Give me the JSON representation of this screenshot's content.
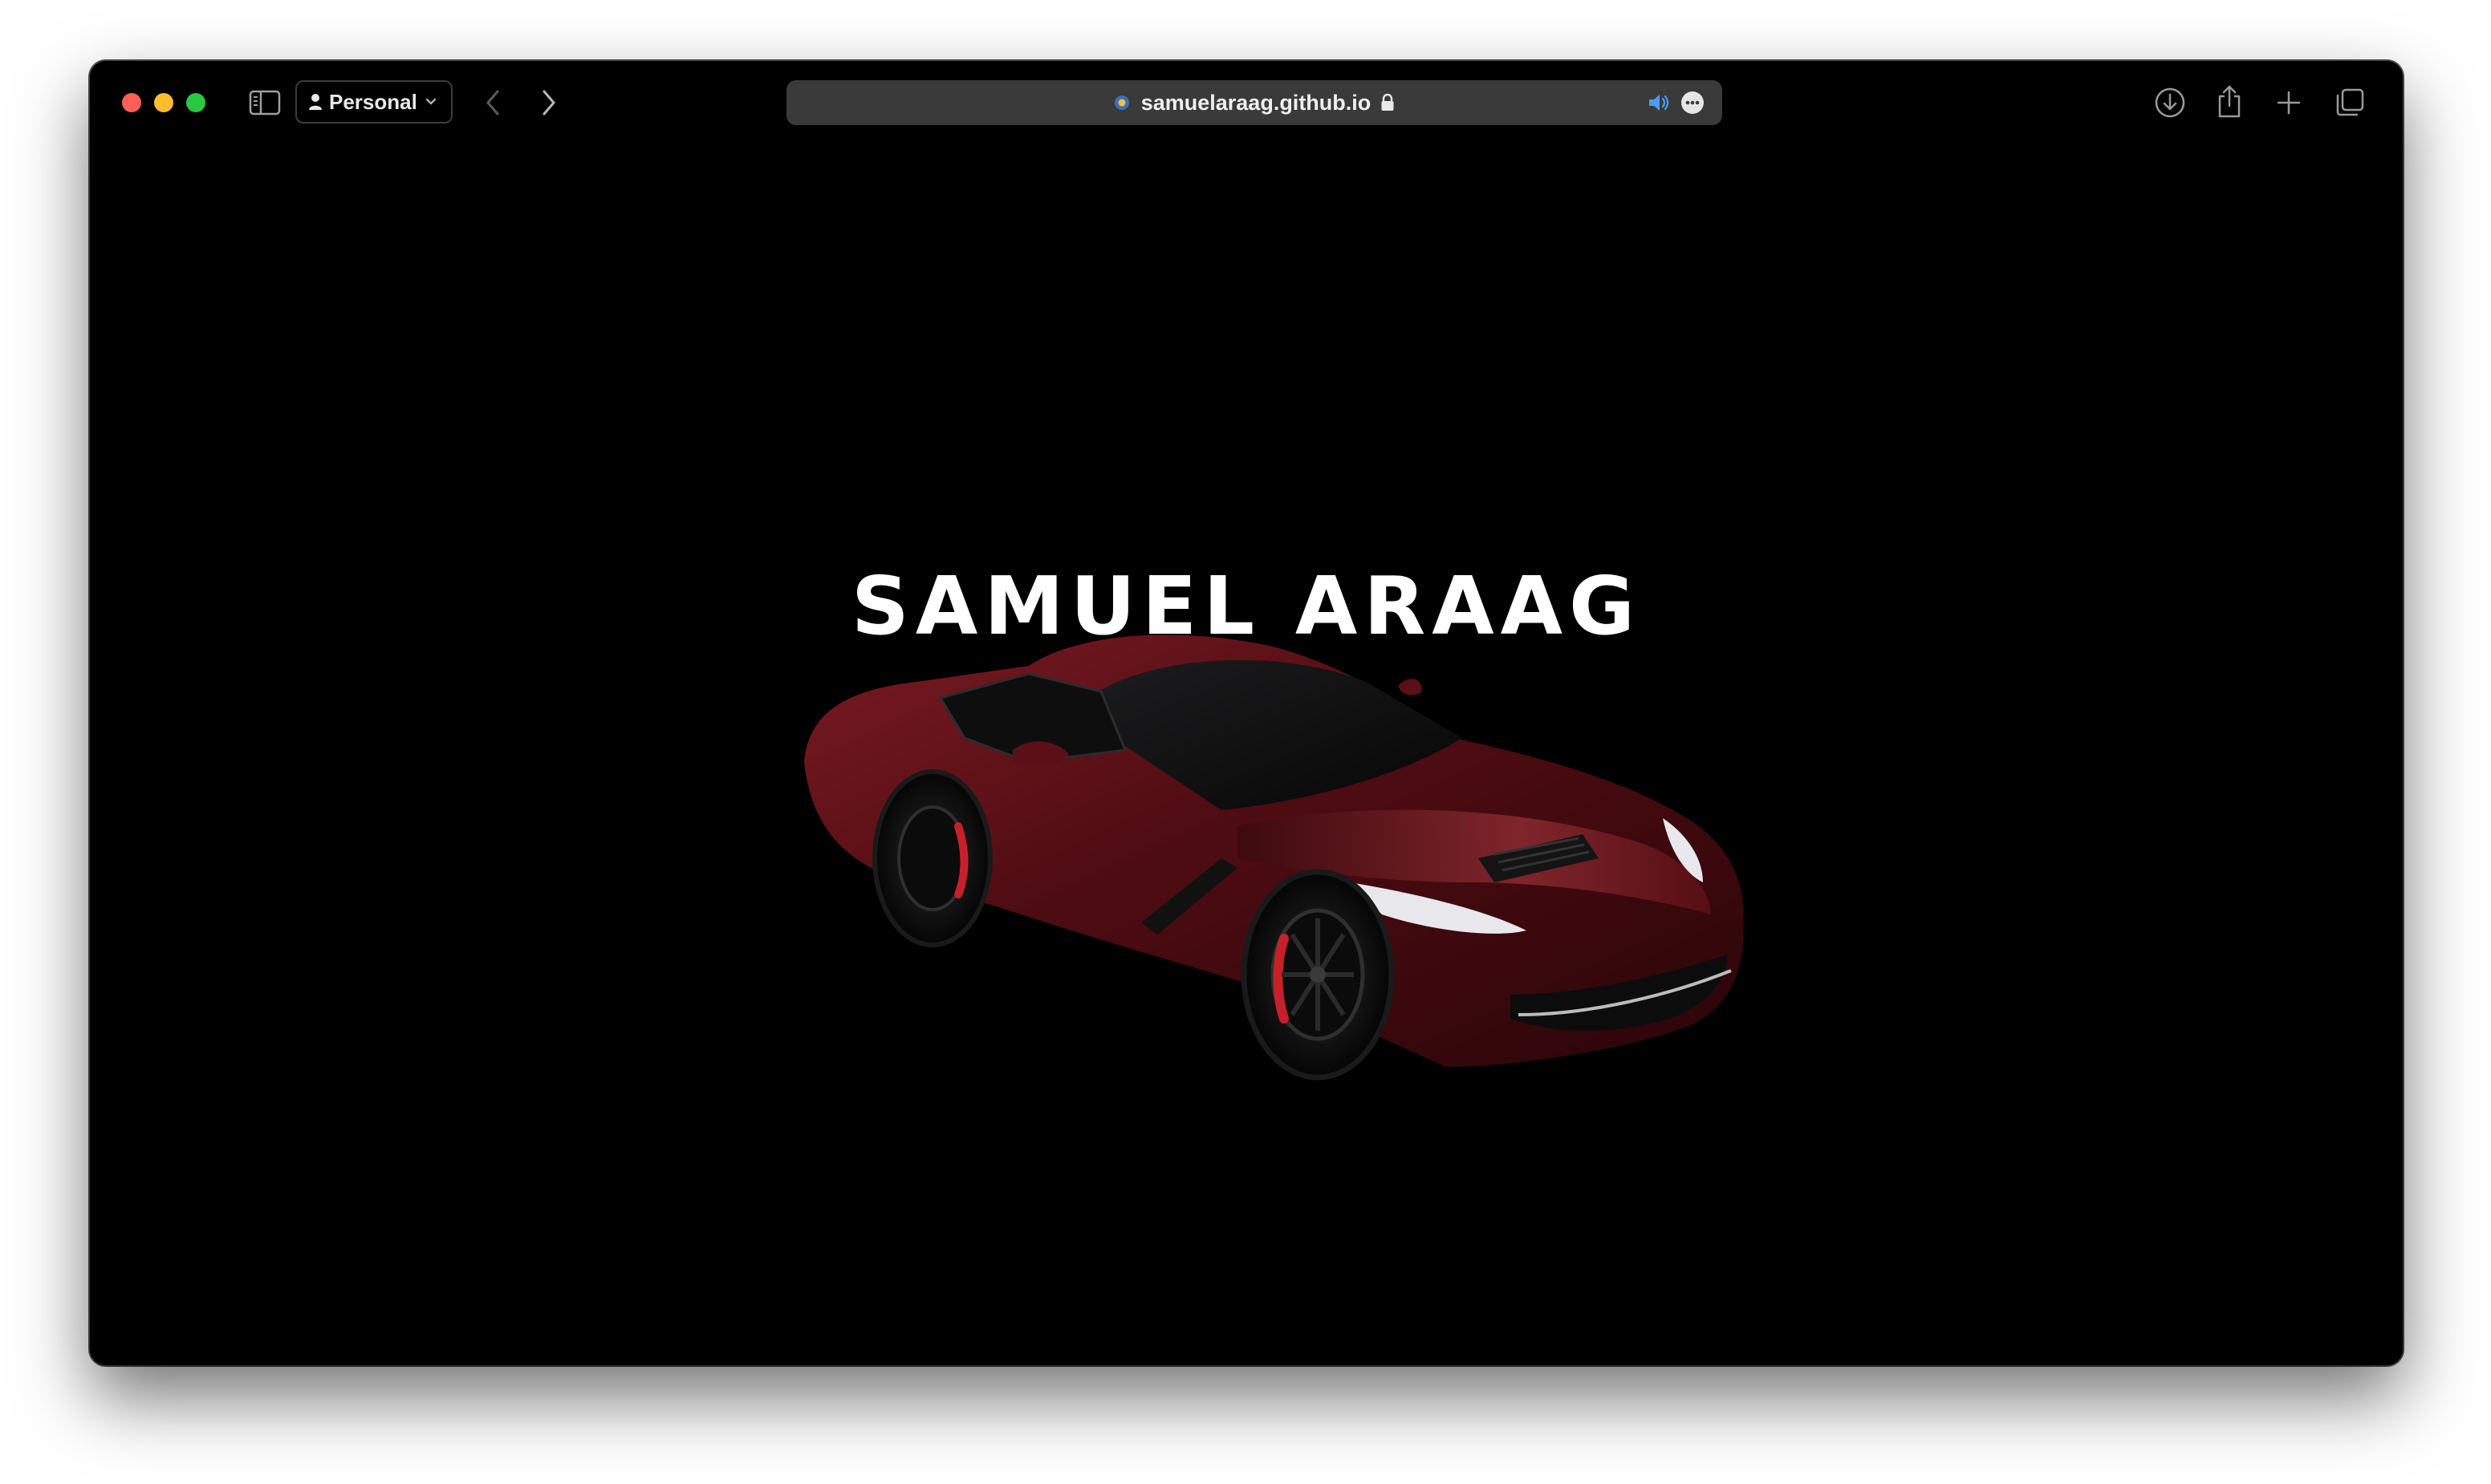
{
  "browser": {
    "profile_label": "Personal",
    "address": "samuelaraag.github.io"
  },
  "page": {
    "title": "SAMUEL ARAAG"
  },
  "colors": {
    "background": "#000000",
    "title_text": "#ffffff",
    "car_body": "#5a0f14",
    "address_bar": "#3a3a3a"
  },
  "icons": [
    "sidebar-icon",
    "person-icon",
    "chevron-down-icon",
    "back-arrow-icon",
    "forward-arrow-icon",
    "site-favicon-icon",
    "lock-icon",
    "speaker-icon",
    "more-icon",
    "download-icon",
    "share-icon",
    "plus-icon",
    "tabs-overview-icon"
  ]
}
